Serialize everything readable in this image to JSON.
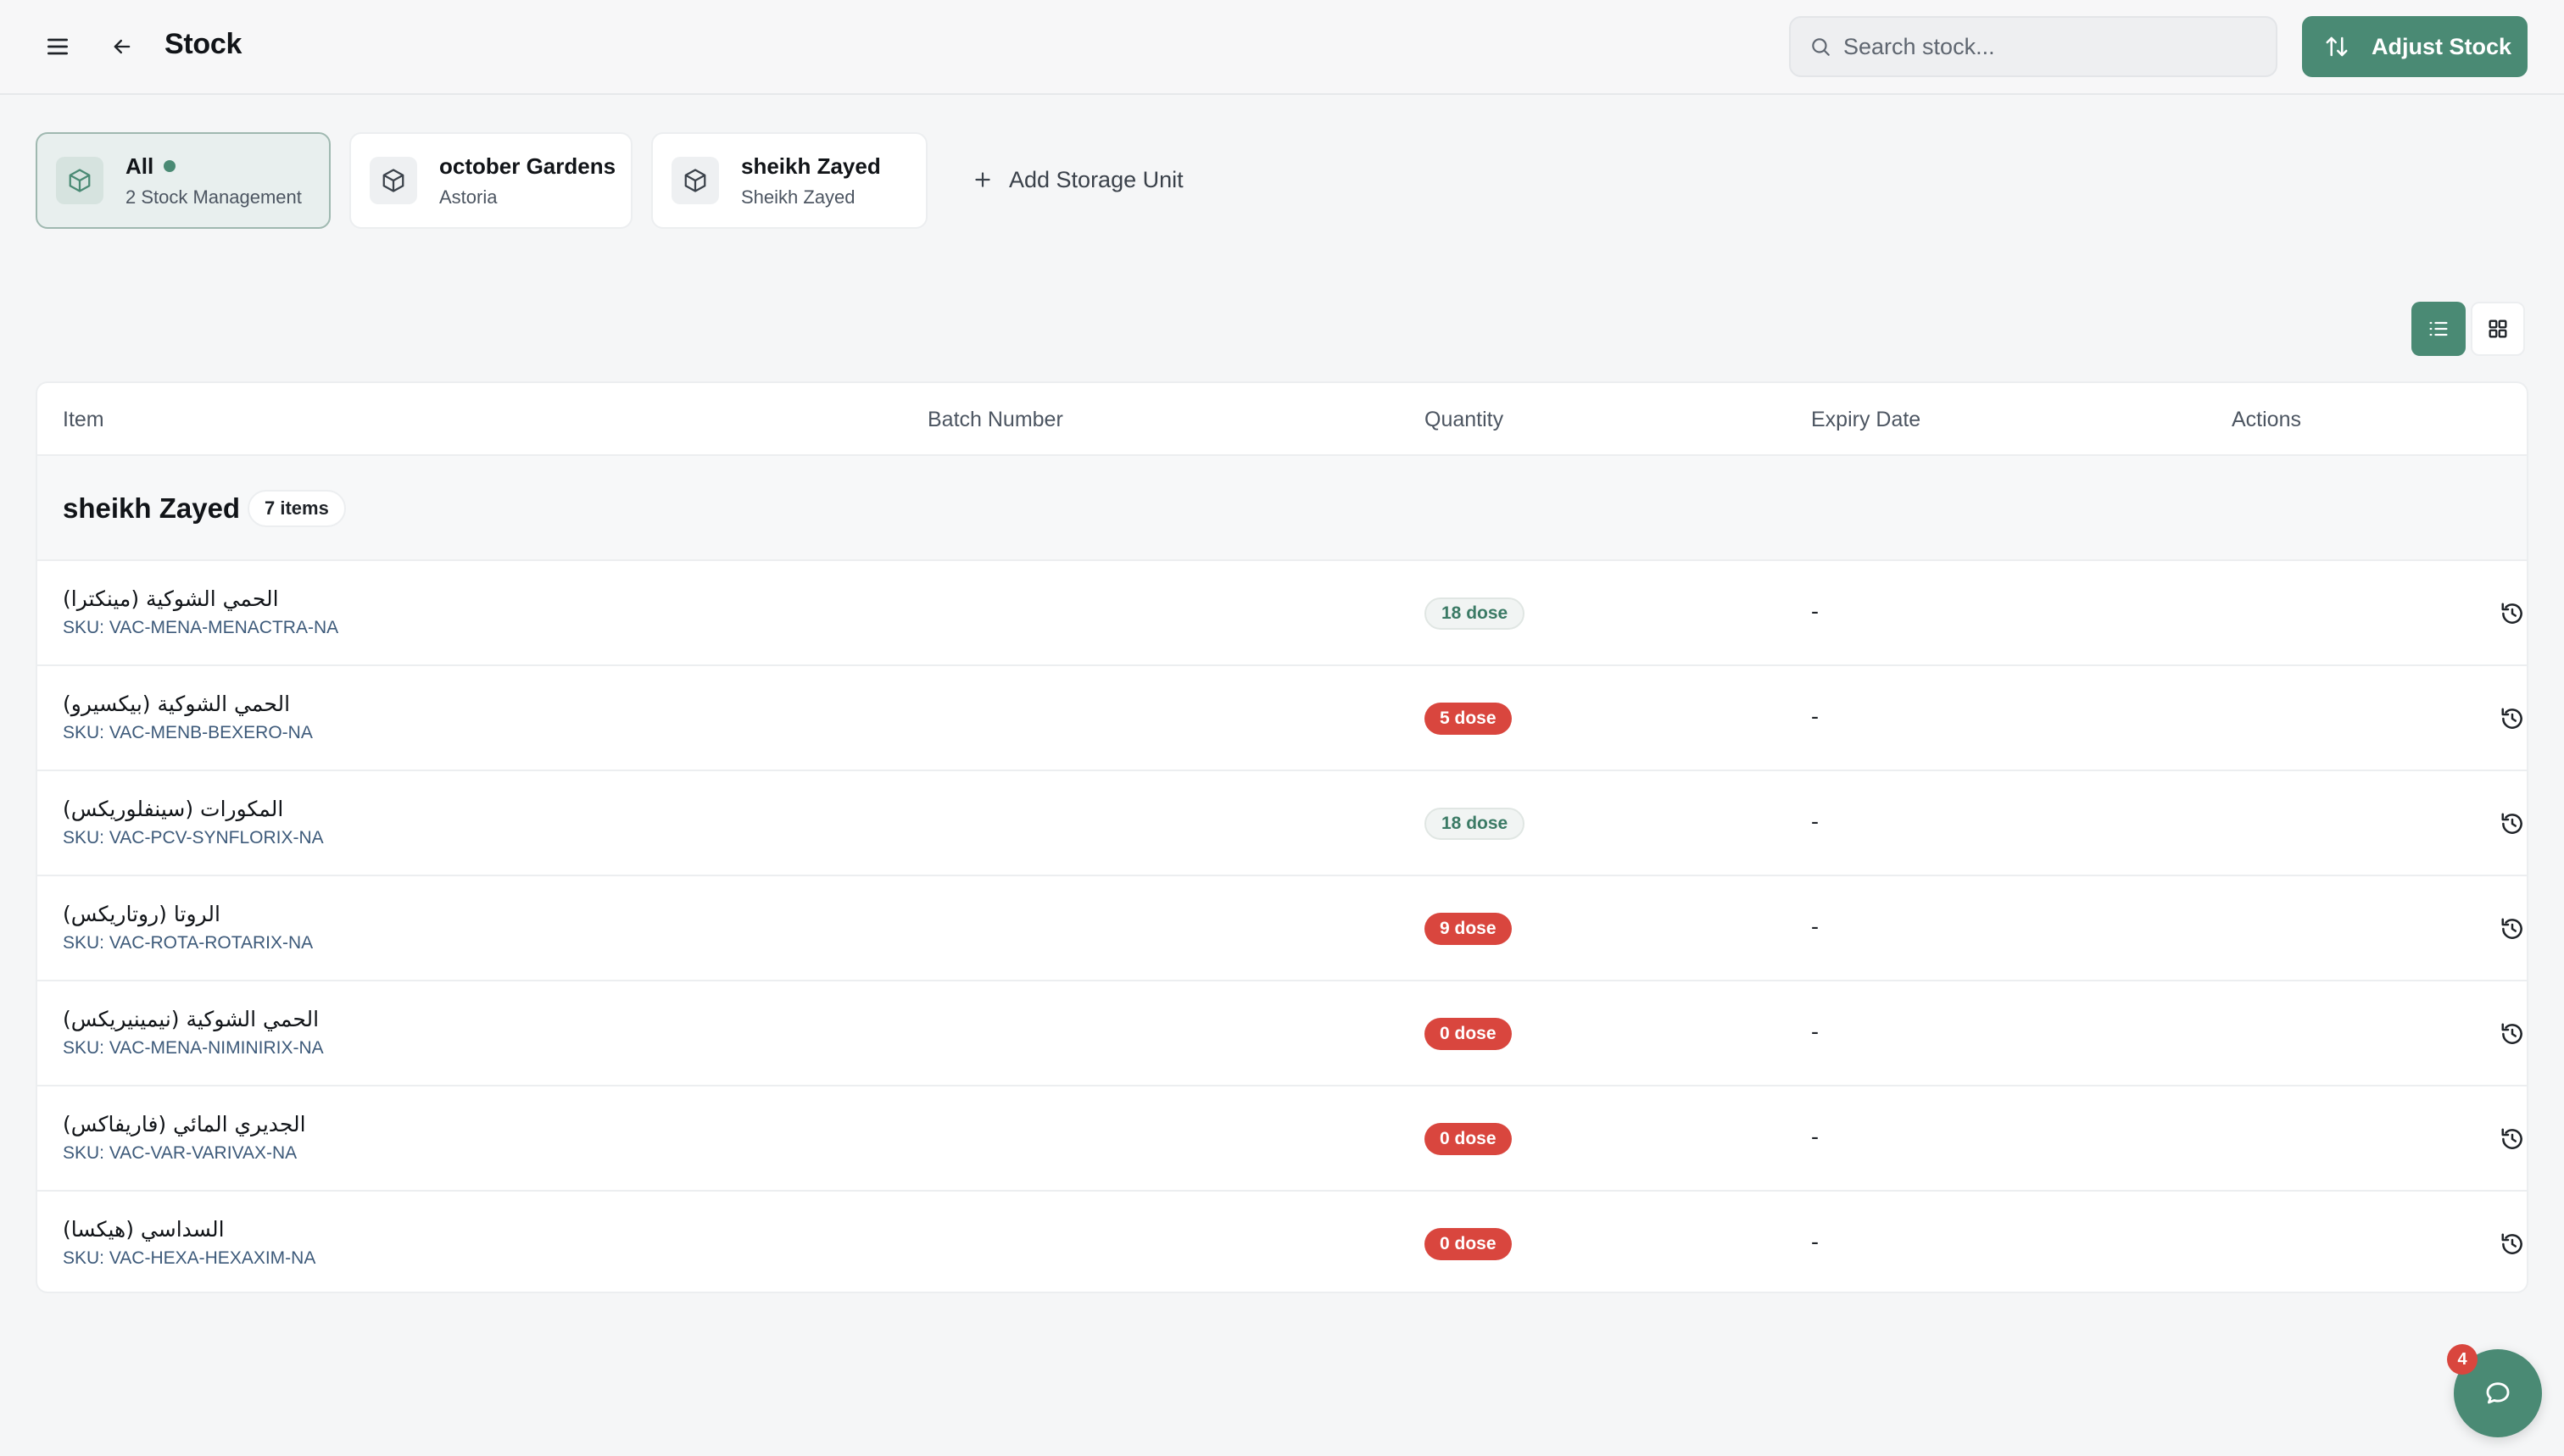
{
  "header": {
    "title": "Stock",
    "search_placeholder": "Search stock...",
    "adjust_label": "Adjust Stock"
  },
  "storage_units": [
    {
      "title": "All",
      "subtitle": "2 Stock Management",
      "active": true
    },
    {
      "title": "october Gardens",
      "subtitle": "Astoria",
      "active": false
    },
    {
      "title": "sheikh Zayed",
      "subtitle": "Sheikh Zayed",
      "active": false
    }
  ],
  "add_storage_label": "Add Storage Unit",
  "table": {
    "columns": [
      "Item",
      "Batch Number",
      "Quantity",
      "Expiry Date",
      "Actions"
    ],
    "group": {
      "title": "sheikh Zayed",
      "badge": "7 items"
    },
    "rows": [
      {
        "name": "الحمي الشوكية (مينكترا)",
        "sku": "SKU: VAC-MENA-MENACTRA-NA",
        "qty": "18 dose",
        "status": "ok",
        "expiry": "-"
      },
      {
        "name": "الحمي الشوكية (بيكسيرو)",
        "sku": "SKU: VAC-MENB-BEXERO-NA",
        "qty": "5 dose",
        "status": "low",
        "expiry": "-"
      },
      {
        "name": "المكورات (سينفلوريكس)",
        "sku": "SKU: VAC-PCV-SYNFLORIX-NA",
        "qty": "18 dose",
        "status": "ok",
        "expiry": "-"
      },
      {
        "name": "الروتا (روتاريكس)",
        "sku": "SKU: VAC-ROTA-ROTARIX-NA",
        "qty": "9 dose",
        "status": "low",
        "expiry": "-"
      },
      {
        "name": "الحمي الشوكية (نيمينيريكس)",
        "sku": "SKU: VAC-MENA-NIMINIRIX-NA",
        "qty": "0 dose",
        "status": "low",
        "expiry": "-"
      },
      {
        "name": "الجديري المائي (فاريفاكس)",
        "sku": "SKU: VAC-VAR-VARIVAX-NA",
        "qty": "0 dose",
        "status": "low",
        "expiry": "-"
      },
      {
        "name": "السداسي (هيكسا)",
        "sku": "SKU: VAC-HEXA-HEXAXIM-NA",
        "qty": "0 dose",
        "status": "low",
        "expiry": "-"
      }
    ]
  },
  "chat": {
    "badge": "4"
  },
  "colors": {
    "accent": "#4a8a74",
    "danger": "#d9463e"
  },
  "icons": {
    "menu": "hamburger-icon",
    "back": "arrow-left-icon",
    "search": "search-icon",
    "adjust": "arrows-up-down-icon",
    "unit": "box-icon",
    "add": "plus-icon",
    "list_view": "list-icon",
    "grid_view": "grid-icon",
    "history": "history-icon",
    "chat": "chat-bubble-icon"
  }
}
